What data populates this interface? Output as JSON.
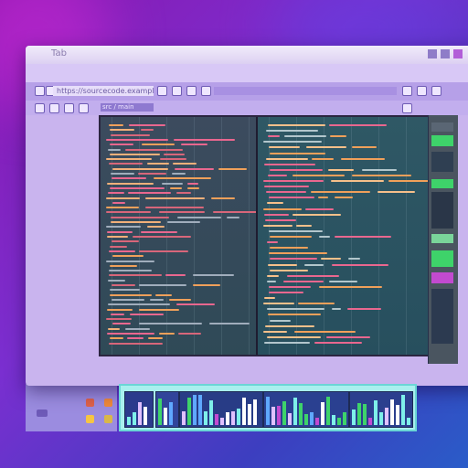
{
  "window": {
    "title": "Tab",
    "address": "https://sourcecode.example/project",
    "breadcrumb": "src / main"
  },
  "editor": {
    "left_pane_lines": 46,
    "right_pane_lines": 40
  },
  "icons": [
    "back-icon",
    "forward-icon",
    "reload-icon",
    "home-icon",
    "lock-icon",
    "star-icon",
    "menu-icon",
    "settings-icon",
    "shield-icon",
    "folder-icon"
  ],
  "colors": {
    "accent_pink": "#e9678f",
    "accent_orange": "#f0a05a",
    "accent_green": "#3ed36a",
    "teal": "#6bd6d6"
  }
}
